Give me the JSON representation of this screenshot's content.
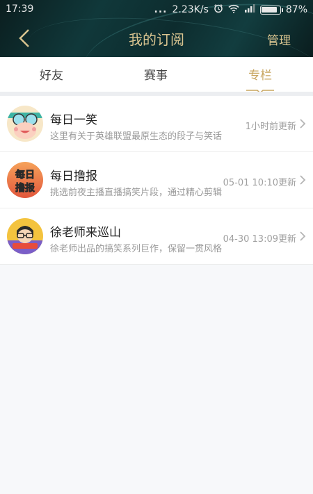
{
  "statusbar": {
    "time": "17:39",
    "dots": "...",
    "network_speed": "2.23K/s",
    "battery": "87%",
    "battery_level": 0.87,
    "icons": [
      "alarm-icon",
      "wifi-icon",
      "signal-icon",
      "battery-icon"
    ]
  },
  "navbar": {
    "back_icon": "chevron-left-icon",
    "title": "我的订阅",
    "manage_label": "管理"
  },
  "tabs": [
    {
      "label": "好友",
      "active": false
    },
    {
      "label": "赛事",
      "active": false
    },
    {
      "label": "专栏",
      "active": true
    }
  ],
  "colors": {
    "accent": "#c8a55f",
    "header_bg": "#0f2f30",
    "title_gold": "#d9c490"
  },
  "subscriptions": [
    {
      "title": "每日一笑",
      "desc": "这里有关于英雄联盟最原生态的段子与笑话",
      "time": "1小时前更新",
      "avatar_icon": "cartoon-face-icon"
    },
    {
      "title": "每日撸报",
      "desc": "挑选前夜主播直播搞笑片段，通过精心剪辑",
      "time": "05-01 10:10更新",
      "avatar_icon": "daily-report-logo-icon",
      "avatar_text": [
        "每日",
        "撸报"
      ]
    },
    {
      "title": "徐老师来巡山",
      "desc": "徐老师出品的搞笑系列巨作，保留一贯风格",
      "time": "04-30 13:09更新",
      "avatar_icon": "teacher-cartoon-icon"
    }
  ]
}
